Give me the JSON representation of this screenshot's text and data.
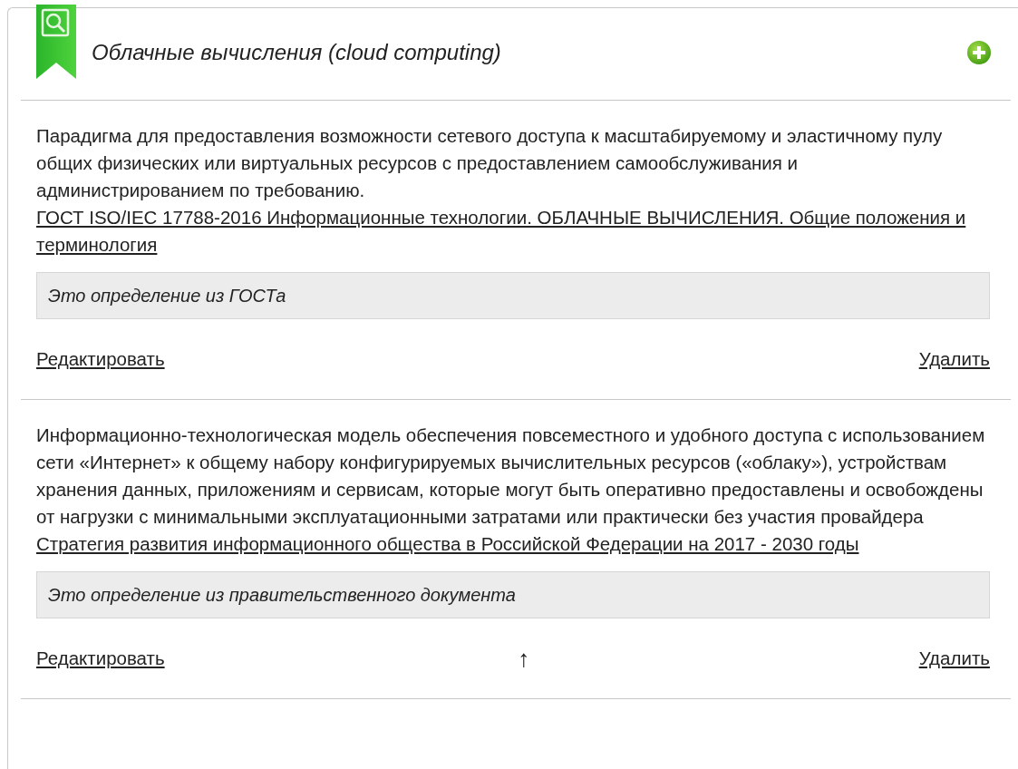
{
  "term": {
    "title": "Облачные вычисления (cloud computing)"
  },
  "definitions": [
    {
      "text": "Парадигма для предоставления возможности сетевого доступа к масштабируемому и эластичному пулу общих физических или виртуальных ресурсов с предоставлением самообслуживания и администрированием по требованию.",
      "source": "ГОСТ ISO/IEC 17788-2016 Информационные технологии. ОБЛАЧНЫЕ ВЫЧИСЛЕНИЯ. Общие положения и терминология",
      "note": "Это определение из ГОСТа",
      "edit": "Редактировать",
      "delete": "Удалить"
    },
    {
      "text": "Информационно-технологическая модель обеспечения повсеместного и удобного доступа с использованием сети «Интернет» к общему набору конфигурируемых вычислительных ресурсов («облаку»), устройствам хранения данных, приложениям и сервисам, которые могут быть оперативно предоставлены и освобождены от нагрузки с минимальными эксплуатационными затратами или практически без участия провайдера",
      "source": "Стратегия развития информационного общества в Российской Федерации на 2017 - 2030 годы",
      "note": "Это определение из правительственного документа",
      "edit": "Редактировать",
      "move_up": "↑",
      "delete": "Удалить"
    }
  ]
}
